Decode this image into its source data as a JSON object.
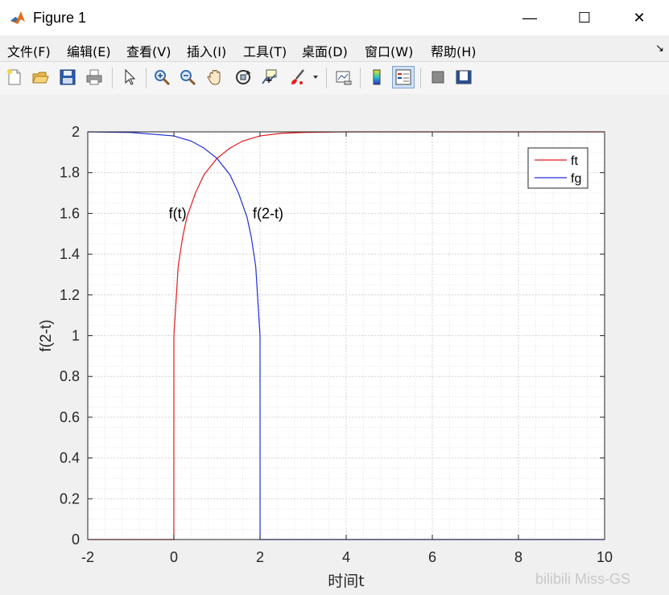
{
  "window": {
    "title": "Figure 1",
    "controls": {
      "minimize": "—",
      "maximize": "☐",
      "close": "✕"
    }
  },
  "menubar": {
    "items": [
      {
        "label": "文件(F)"
      },
      {
        "label": "编辑(E)"
      },
      {
        "label": "查看(V)"
      },
      {
        "label": "插入(I)"
      },
      {
        "label": "工具(T)"
      },
      {
        "label": "桌面(D)"
      },
      {
        "label": "窗口(W)"
      },
      {
        "label": "帮助(H)"
      }
    ],
    "dock_glyph": "↘"
  },
  "toolbar": {
    "buttons": [
      {
        "icon": "new-figure-icon"
      },
      {
        "icon": "open-file-icon"
      },
      {
        "icon": "save-icon"
      },
      {
        "icon": "print-icon"
      },
      {
        "icon": "pointer-icon"
      },
      {
        "icon": "zoom-in-icon"
      },
      {
        "icon": "zoom-out-icon"
      },
      {
        "icon": "pan-icon"
      },
      {
        "icon": "rotate-3d-icon"
      },
      {
        "icon": "data-cursor-icon"
      },
      {
        "icon": "brush-icon"
      },
      {
        "icon": "link-plot-icon"
      },
      {
        "icon": "insert-colorbar-icon"
      },
      {
        "icon": "insert-legend-icon"
      },
      {
        "icon": "hide-plot-tools-icon"
      },
      {
        "icon": "show-plot-tools-icon"
      }
    ],
    "active_button": "insert-legend-icon"
  },
  "colors": {
    "ft": "#e41a1c",
    "fg": "#1f2fd6",
    "axes_bg": "#ffffff",
    "grid": "#d9d9d9"
  },
  "chart_data": {
    "type": "line",
    "xlabel": "时间t",
    "ylabel": "f(2-t)",
    "xlim": [
      -2,
      10
    ],
    "ylim": [
      0,
      2
    ],
    "xticks": [
      "-2",
      "0",
      "2",
      "4",
      "6",
      "8",
      "10"
    ],
    "yticks": [
      "0",
      "0.2",
      "0.4",
      "0.6",
      "0.8",
      "1",
      "1.2",
      "1.4",
      "1.6",
      "1.8",
      "2"
    ],
    "grid": "major and minor (dotted)",
    "legend_position": "top-right",
    "series": [
      {
        "name": "ft",
        "color": "#e41a1c",
        "x": [
          -2,
          -0.001,
          0,
          0.1,
          0.2,
          0.3,
          0.5,
          0.7,
          1.0,
          1.3,
          1.6,
          2.0,
          2.5,
          3.0,
          4.0,
          10
        ],
        "y": [
          0,
          0,
          1.0,
          1.34,
          1.48,
          1.58,
          1.7,
          1.79,
          1.87,
          1.92,
          1.955,
          1.98,
          1.993,
          1.997,
          2.0,
          2.0
        ]
      },
      {
        "name": "fg",
        "color": "#1f2fd6",
        "x": [
          -2,
          -1,
          0,
          0.4,
          0.7,
          1.0,
          1.3,
          1.5,
          1.7,
          1.8,
          1.9,
          2.0,
          2.001,
          10
        ],
        "y": [
          2.0,
          1.997,
          1.98,
          1.955,
          1.92,
          1.87,
          1.79,
          1.7,
          1.58,
          1.48,
          1.34,
          1.0,
          0,
          0
        ]
      }
    ],
    "annotations": [
      {
        "text": "f(t)",
        "x": 0.05,
        "y": 1.6
      },
      {
        "text": "f(2-t)",
        "x": 2.0,
        "y": 1.6
      }
    ]
  },
  "watermark": "bilibili Miss-GS"
}
